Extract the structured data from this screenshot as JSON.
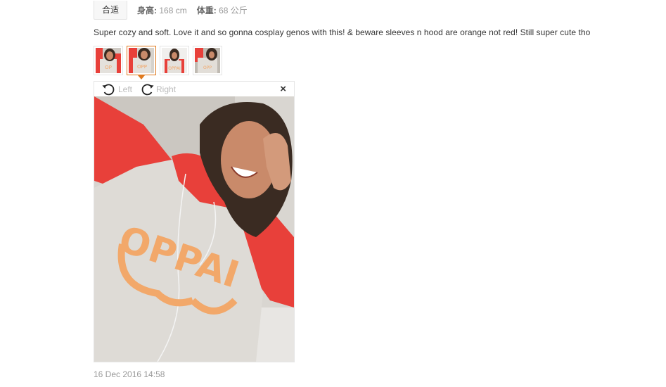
{
  "fit": {
    "label": "合适"
  },
  "attrs": {
    "height_label": "身高:",
    "height_value": "168 cm",
    "weight_label": "体重:",
    "weight_value": "68 公斤"
  },
  "review": {
    "text": "Super cozy and soft. Love it and so gonna cosplay genos with this! & beware sleeves n hood are orange not red! Still super cute tho",
    "date": "16 Dec 2016 14:58"
  },
  "viewer": {
    "rotate_left": "Left",
    "rotate_right": "Right",
    "close": "×",
    "shirt_text": "OPPAI"
  },
  "colors": {
    "accent": "#e07a1f",
    "sleeve_red": "#e8403a",
    "shirt_grey": "#dedbd6",
    "print_orange": "#f2a86a"
  }
}
